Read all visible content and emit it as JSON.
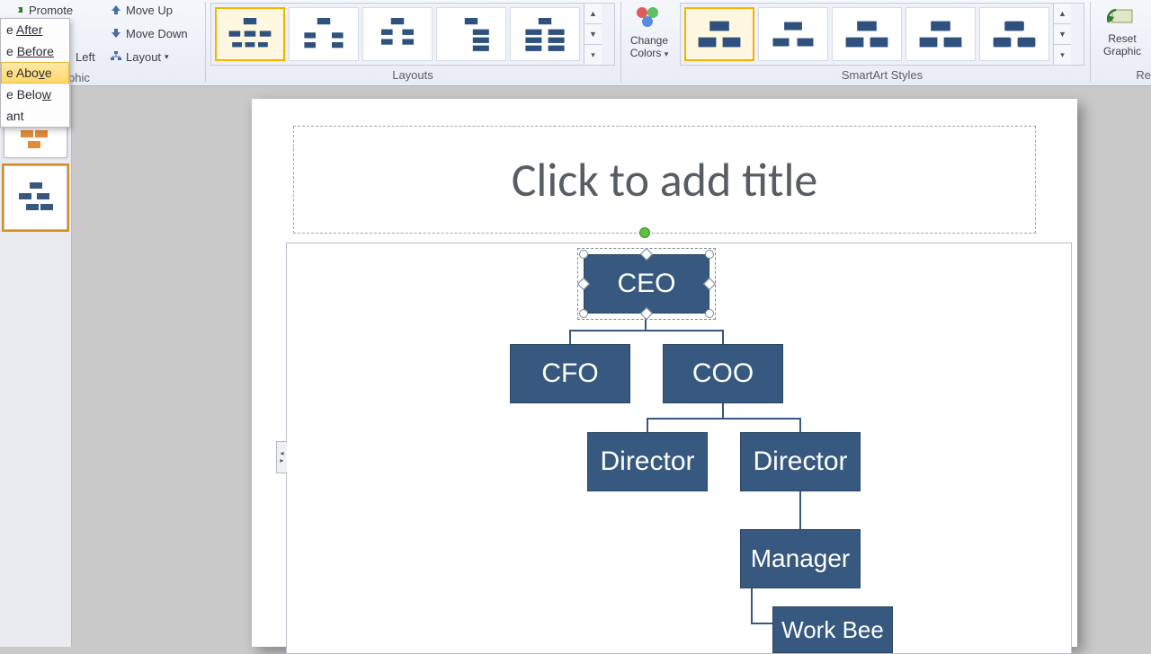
{
  "ribbon": {
    "create": {
      "promote": "Promote",
      "move_up": "Move Up",
      "move_down": "Move Down",
      "left": "Left",
      "layout": "Layout",
      "group_label_suffix": "phic"
    },
    "add_shape_menu": {
      "after": "After",
      "before": "Before",
      "above": "Above",
      "below": "Below",
      "assistant": "ant"
    },
    "layouts": {
      "group_label": "Layouts"
    },
    "change_colors": {
      "line1": "Change",
      "line2": "Colors"
    },
    "styles": {
      "group_label": "SmartArt Styles"
    },
    "reset": {
      "line1": "Reset",
      "line2": "Graphic",
      "group_label_suffix": "Re"
    }
  },
  "slide": {
    "title_placeholder": "Click to add title"
  },
  "org_chart": {
    "ceo": "CEO",
    "cfo": "CFO",
    "coo": "COO",
    "director1": "Director",
    "director2": "Director",
    "manager": "Manager",
    "workbee": "Work Bee"
  },
  "colors": {
    "node": "#37597f",
    "selection_gold": "#f2b200"
  }
}
